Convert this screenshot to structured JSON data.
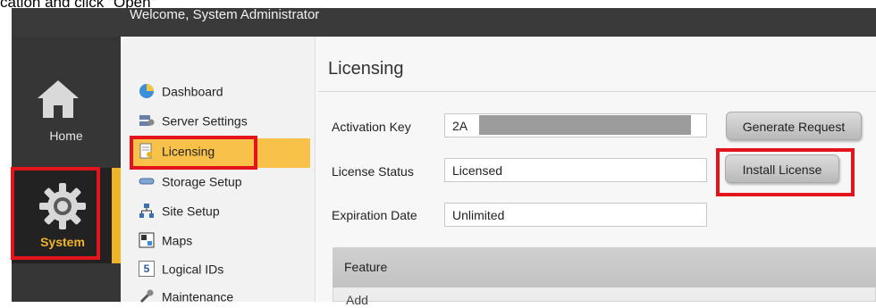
{
  "caption": "cation and click \"Open\"",
  "header": {
    "welcome": "Welcome, System Administrator"
  },
  "nav": {
    "home_label": "Home",
    "system_label": "System",
    "accent": "#f0b429",
    "highlight": "#e3141c"
  },
  "menu": [
    {
      "label": "Dashboard",
      "icon": "dashboard-icon"
    },
    {
      "label": "Server Settings",
      "icon": "server-settings-icon"
    },
    {
      "label": "Licensing",
      "icon": "licensing-icon"
    },
    {
      "label": "Storage Setup",
      "icon": "storage-icon"
    },
    {
      "label": "Site Setup",
      "icon": "site-setup-icon"
    },
    {
      "label": "Maps",
      "icon": "maps-icon"
    },
    {
      "label": "Logical IDs",
      "icon": "logical-ids-icon",
      "badge": "5"
    },
    {
      "label": "Maintenance",
      "icon": "maintenance-icon"
    }
  ],
  "page": {
    "title": "Licensing",
    "activation_label": "Activation Key",
    "activation_value": "2A",
    "status_label": "License Status",
    "status_value": "Licensed",
    "expiration_label": "Expiration Date",
    "expiration_value": "Unlimited",
    "generate_button": "Generate Request",
    "install_button": "Install License",
    "feature_header": "Feature",
    "partial_row": "Add"
  }
}
